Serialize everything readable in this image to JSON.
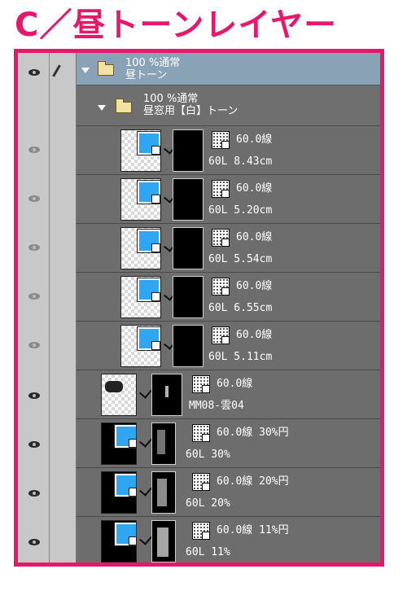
{
  "heading": "C／昼トーンレイヤー",
  "colors": {
    "accent": "#e5186a",
    "panel": "#6d6d6d",
    "group": "#8aa2b6",
    "tone_blue": "#2ea6f2"
  },
  "group_main": {
    "opacity": "100 %通常",
    "name": "昼トーン"
  },
  "group_sub": {
    "opacity": "100 %通常",
    "name": "昼窓用【白】トーン"
  },
  "layers": [
    {
      "tone": "60.0線",
      "info": "60L 8.43cm"
    },
    {
      "tone": "60.0線",
      "info": "60L 5.20cm"
    },
    {
      "tone": "60.0線",
      "info": "60L 5.54cm"
    },
    {
      "tone": "60.0線",
      "info": "60L 6.55cm"
    },
    {
      "tone": "60.0線",
      "info": "60L 5.11cm"
    },
    {
      "tone": "60.0線",
      "info": "MM08-雲04"
    },
    {
      "tone": "60.0線 30%円",
      "info": "60L 30%"
    },
    {
      "tone": "60.0線 20%円",
      "info": "60L 20%"
    },
    {
      "tone": "60.0線 11%円",
      "info": "60L 11%"
    }
  ]
}
